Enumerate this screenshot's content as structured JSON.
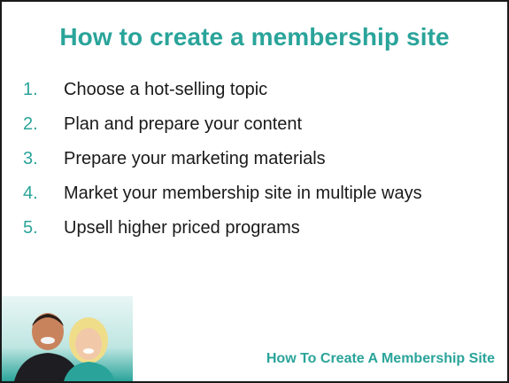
{
  "slide": {
    "title": "How to create a membership site",
    "items": [
      {
        "num": "1.",
        "text": "Choose a hot-selling topic"
      },
      {
        "num": "2.",
        "text": "Plan and prepare your content"
      },
      {
        "num": "3.",
        "text": "Prepare your marketing materials"
      },
      {
        "num": "4.",
        "text": "Market your membership site in multiple ways"
      },
      {
        "num": "5.",
        "text": "Upsell higher priced programs"
      }
    ],
    "footer": "How To Create A Membership Site"
  },
  "colors": {
    "accent": "#2aa49a",
    "text": "#1a1a1a",
    "border": "#1a1a1a"
  }
}
